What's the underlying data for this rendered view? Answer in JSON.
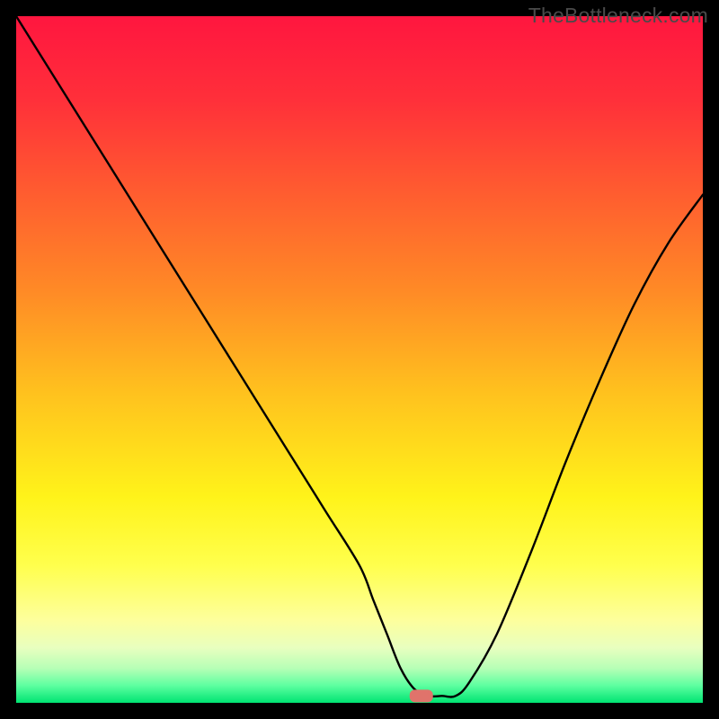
{
  "watermark": "TheBottleneck.com",
  "chart_data": {
    "type": "line",
    "title": "",
    "xlabel": "",
    "ylabel": "",
    "xlim": [
      0,
      100
    ],
    "ylim": [
      0,
      100
    ],
    "grid": false,
    "legend": false,
    "background_gradient": {
      "stops": [
        {
          "offset": 0.0,
          "color": "#ff163f"
        },
        {
          "offset": 0.12,
          "color": "#ff2f3a"
        },
        {
          "offset": 0.25,
          "color": "#ff5a30"
        },
        {
          "offset": 0.4,
          "color": "#ff8a26"
        },
        {
          "offset": 0.55,
          "color": "#ffc21e"
        },
        {
          "offset": 0.7,
          "color": "#fff31a"
        },
        {
          "offset": 0.8,
          "color": "#ffff4d"
        },
        {
          "offset": 0.88,
          "color": "#fdff9d"
        },
        {
          "offset": 0.92,
          "color": "#e8ffbf"
        },
        {
          "offset": 0.95,
          "color": "#b6ffb6"
        },
        {
          "offset": 0.975,
          "color": "#5dffa0"
        },
        {
          "offset": 1.0,
          "color": "#00e472"
        }
      ]
    },
    "series": [
      {
        "name": "bottleneck-curve",
        "color": "#000000",
        "x": [
          0,
          5,
          10,
          15,
          20,
          25,
          30,
          35,
          40,
          45,
          50,
          52,
          54,
          56,
          58,
          60,
          62,
          64,
          66,
          70,
          75,
          80,
          85,
          90,
          95,
          100
        ],
        "y": [
          100,
          92,
          84,
          76,
          68,
          60,
          52,
          44,
          36,
          28,
          20,
          15,
          10,
          5,
          2,
          1,
          1,
          1,
          3,
          10,
          22,
          35,
          47,
          58,
          67,
          74
        ]
      }
    ],
    "marker": {
      "name": "optimal-point",
      "x": 59,
      "y": 1,
      "color": "#e0736b",
      "shape": "rounded-rect"
    }
  }
}
